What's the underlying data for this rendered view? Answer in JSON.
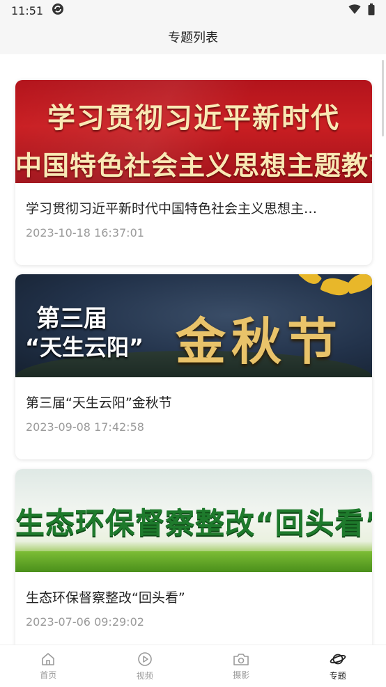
{
  "status": {
    "time": "11:51"
  },
  "header": {
    "title": "专题列表"
  },
  "topics": [
    {
      "banner_lines": [
        "学习贯彻习近平新时代",
        "中国特色社会主义思想主题教育"
      ],
      "title": "学习贯彻习近平新时代中国特色社会主义思想主…",
      "date": "2023-10-18 16:37:01"
    },
    {
      "banner_lines": [
        "第三届",
        "“天生云阳”",
        "金秋节"
      ],
      "title": "第三届“天生云阳”金秋节",
      "date": "2023-09-08 17:42:58"
    },
    {
      "banner_lines": [
        "生态环保督察整改“回头看”"
      ],
      "title": "生态环保督察整改“回头看”",
      "date": "2023-07-06 09:29:02"
    }
  ],
  "tabbar": {
    "items": [
      {
        "label": "首页",
        "icon": "home-icon"
      },
      {
        "label": "视频",
        "icon": "play-icon"
      },
      {
        "label": "摄影",
        "icon": "camera-icon"
      },
      {
        "label": "专题",
        "icon": "planet-icon",
        "active": true
      }
    ]
  }
}
